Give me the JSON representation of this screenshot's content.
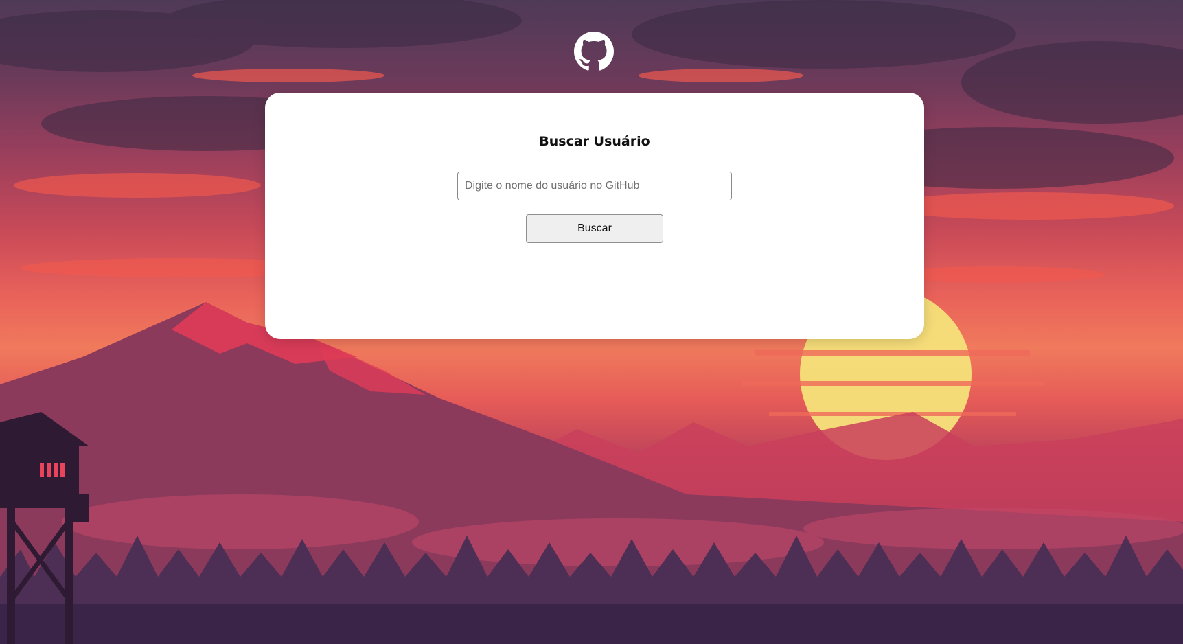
{
  "header": {
    "logo_icon": "github-icon"
  },
  "card": {
    "title": "Buscar Usuário",
    "search": {
      "placeholder": "Digite o nome do usuário no GitHub",
      "value": ""
    },
    "button_label": "Buscar"
  },
  "colors": {
    "card_background": "#ffffff",
    "button_background": "#efefef",
    "sky_top": "#4e3a58",
    "sky_middle": "#e9625a",
    "sun": "#f6e27a"
  }
}
